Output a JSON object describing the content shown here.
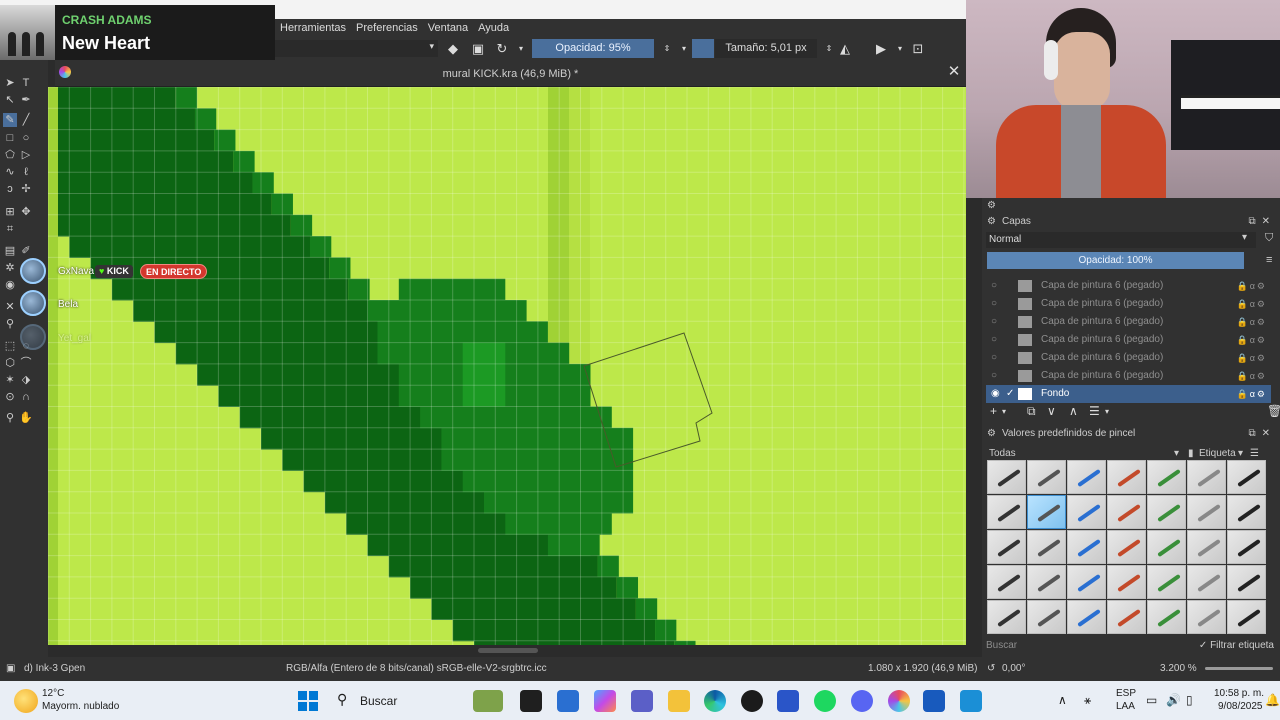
{
  "music": {
    "artist": "CRASH ADAMS",
    "song": "New Heart"
  },
  "menu": [
    "Herramientas",
    "Preferencias",
    "Ventana",
    "Ayuda"
  ],
  "toolbar": {
    "opacity": "Opacidad: 95%",
    "size": "Tamaño: 5,01 px"
  },
  "document": {
    "title": "mural KICK.kra (46,9 MiB) *"
  },
  "stream": {
    "user1": "GxNava",
    "platform": "KICK",
    "live_label": "EN DIRECTO",
    "user2": "Bela",
    "user3": "Yet_gal"
  },
  "layers_panel": {
    "title": "Capas",
    "blend_mode": "Normal",
    "opacity": "Opacidad:  100%",
    "layers": [
      {
        "name": "Capa de pintura 6 (pegado)",
        "active": false
      },
      {
        "name": "Capa de pintura 6 (pegado)",
        "active": false
      },
      {
        "name": "Capa de pintura 6 (pegado)",
        "active": false
      },
      {
        "name": "Capa de pintura 6 (pegado)",
        "active": false
      },
      {
        "name": "Capa de pintura 6 (pegado)",
        "active": false
      },
      {
        "name": "Capa de pintura 6 (pegado)",
        "active": false
      },
      {
        "name": "Fondo",
        "active": true
      }
    ]
  },
  "brush_presets": {
    "title": "Valores predefinidos de pincel",
    "filter": "Todas",
    "tag_label": "Etiqueta",
    "search_placeholder": "Buscar",
    "filter_tag": "Filtrar etiqueta",
    "selected_index": 8
  },
  "status": {
    "brush": "d) Ink-3 Gpen",
    "colorspace": "RGB/Alfa (Entero de 8 bits/canal)  sRGB-elle-V2-srgbtrc.icc",
    "dimensions": "1.080 x 1.920 (46,9 MiB)",
    "rotation": "0,00°",
    "zoom": "3.200 %"
  },
  "taskbar": {
    "temp": "12°C",
    "weather": "Mayorm. nublado",
    "search": "Buscar",
    "lang1": "ESP",
    "lang2": "LAA",
    "time": "10:58 p. m.",
    "date": "9/08/2025"
  },
  "colors": {
    "canvas_light": "#bde84a",
    "canvas_mid": "#a0d235",
    "canvas_dark": "#157f1c",
    "canvas_darker": "#0c6513",
    "accent_blue": "#4a6f9c"
  }
}
